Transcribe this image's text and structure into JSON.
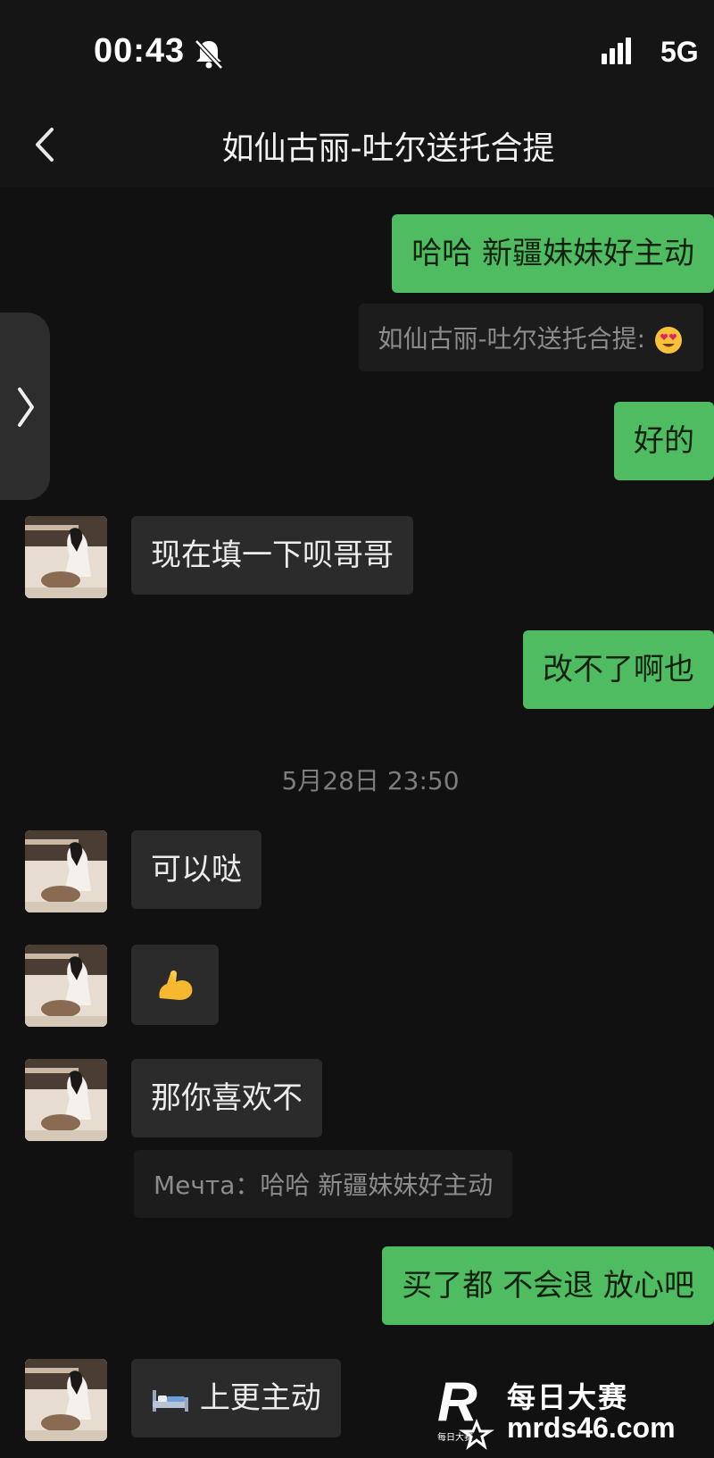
{
  "status_bar": {
    "time": "00:43",
    "network": "5G"
  },
  "chat": {
    "title": "如仙古丽-吐尔送托合提"
  },
  "messages": {
    "m1": "哈哈 新疆妹妹好主动",
    "q1": "如仙古丽-吐尔送托合提:",
    "m2": "好的",
    "m3": "现在填一下呗哥哥",
    "m4": "改不了啊也",
    "m5": "可以哒",
    "m7": "那你喜欢不",
    "q2": "Мечта：哈哈 新疆妹妹好主动",
    "m8": "买了都 不会退 放心吧",
    "m9": "上更主动"
  },
  "timestamp": "5月28日 23:50",
  "watermark": {
    "logo_letter": "R",
    "sub": "每日大赛",
    "cn": "每日大赛",
    "url": "mrds46.com"
  },
  "colors": {
    "outgoing": "#4fbc62",
    "incoming": "#2b2b2b",
    "background": "#111111"
  }
}
